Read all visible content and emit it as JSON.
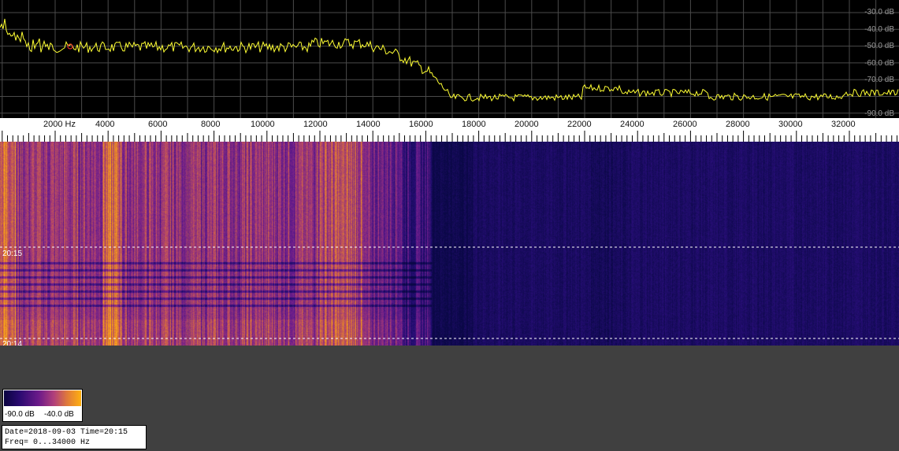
{
  "spectrum": {
    "db_labels": [
      "-30.0 dB",
      "-40.0 dB",
      "-50.0 dB",
      "-60.0 dB",
      "-70.0 dB",
      "-90.0 dB"
    ],
    "trace_color": "#ffff33",
    "grid_color": "#4a4a4a"
  },
  "freq_axis": {
    "labels": [
      "2000 Hz",
      "4000",
      "6000",
      "8000",
      "10000",
      "12000",
      "14000",
      "16000",
      "18000",
      "20000",
      "22000",
      "24000",
      "26000",
      "28000",
      "30000",
      "32000"
    ]
  },
  "waterfall": {
    "time_labels": [
      "20:15",
      "20:14"
    ]
  },
  "colorbar": {
    "min_label": "-90.0 dB",
    "max_label": "-40.0 dB"
  },
  "info": {
    "line1": "Date=2018-09-03 Time=20:15",
    "line2": "Freq= 0...34000 Hz"
  }
}
